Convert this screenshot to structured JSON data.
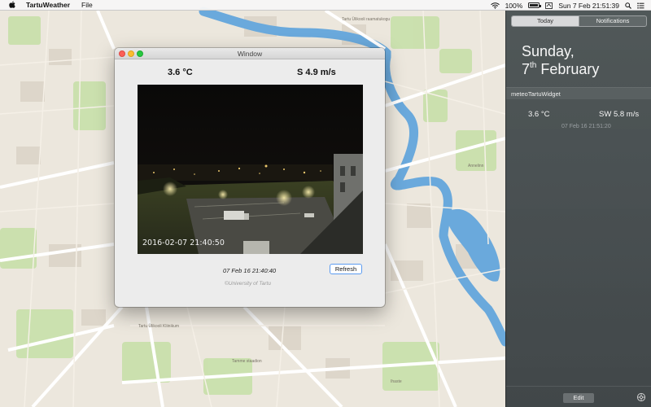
{
  "menubar": {
    "app_name": "TartuWeather",
    "menus": [
      "File"
    ],
    "battery_percent": "100%",
    "clock": "Sun 7 Feb  21:51:39"
  },
  "window": {
    "title": "Window",
    "temperature": "3.6 °C",
    "wind": "S 4.9 m/s",
    "webcam_timestamp": "2016-02-07 21:40:50",
    "last_update": "07 Feb 16 21:40:40",
    "refresh_label": "Refresh",
    "copyright": "©University of Tartu"
  },
  "notification_center": {
    "tabs": [
      "Today",
      "Notifications"
    ],
    "day": "Sunday,",
    "date_number": "7",
    "date_suffix": "th",
    "month": "February",
    "widget": {
      "name": "meteoTartuWidget",
      "temperature": "3.6 °C",
      "wind": "SW 5.8 m/s",
      "updated": "07 Feb 16 21:51:20"
    },
    "edit_label": "Edit"
  },
  "map_labels": {
    "library": "Tartu Ülikooli raamatukogu",
    "library2": "Tartu Ülikooli Kliinikum",
    "park": "Tamme staadion",
    "label_a": "Annelinn",
    "label_b": "Ihaste"
  },
  "colors": {
    "accent": "#5b9bf0",
    "river": "#6aa9dc",
    "park": "#c6dfa8",
    "road": "#ffffff"
  }
}
